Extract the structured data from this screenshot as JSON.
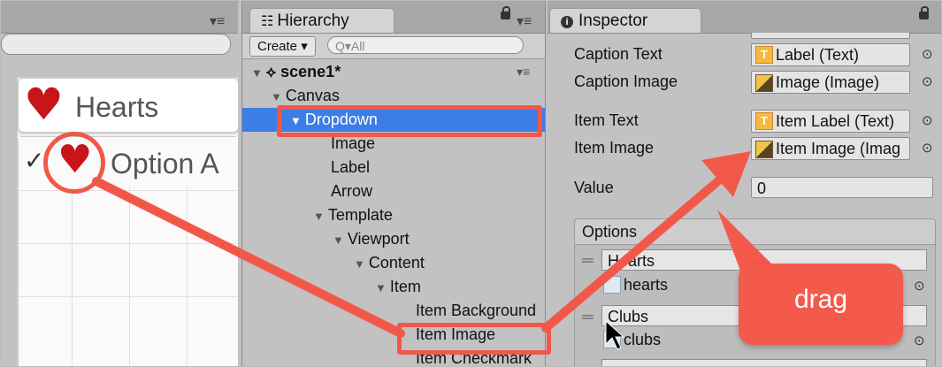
{
  "left_panel": {
    "game": {
      "dropdown_caption": "Hearts",
      "option_label": "Option A",
      "checkmark": "✓",
      "heart_glyph": "♥"
    }
  },
  "hierarchy": {
    "tab_title": "Hierarchy",
    "create_label": "Create ▾",
    "search_placeholder": "Q▾All",
    "scene_name": "scene1*",
    "items": [
      {
        "label": "Canvas",
        "expanded": true
      },
      {
        "label": "Dropdown",
        "expanded": true,
        "selected": true
      },
      {
        "label": "Image"
      },
      {
        "label": "Label"
      },
      {
        "label": "Arrow"
      },
      {
        "label": "Template",
        "expanded": true
      },
      {
        "label": "Viewport",
        "expanded": true
      },
      {
        "label": "Content",
        "expanded": true
      },
      {
        "label": "Item",
        "expanded": true
      },
      {
        "label": "Item Background"
      },
      {
        "label": "Item Image"
      },
      {
        "label": "Item Checkmark"
      }
    ]
  },
  "inspector": {
    "tab_title": "Inspector",
    "fields": {
      "caption_text": {
        "label": "Caption Text",
        "value": "Label (Text)"
      },
      "caption_image": {
        "label": "Caption Image",
        "value": "Image (Image)"
      },
      "item_text": {
        "label": "Item Text",
        "value": "Item Label (Text)"
      },
      "item_image": {
        "label": "Item Image",
        "value": "Item Image (Imag"
      },
      "value": {
        "label": "Value",
        "value": "0"
      }
    },
    "options": {
      "header": "Options",
      "list": [
        {
          "text": "Hearts",
          "sprite": "hearts"
        },
        {
          "text": "Clubs",
          "sprite": "clubs"
        }
      ]
    }
  },
  "annotation": {
    "callout_text": "drag",
    "accent_color": "#f2584a"
  },
  "icons": {
    "unity_icon": "unity-logo-icon",
    "info_icon": "info-icon",
    "lock_icon": "lock-icon",
    "menu_icon": "menu-icon",
    "target_icon": "object-picker-icon",
    "drag_handle_icon": "drag-handle-icon"
  }
}
